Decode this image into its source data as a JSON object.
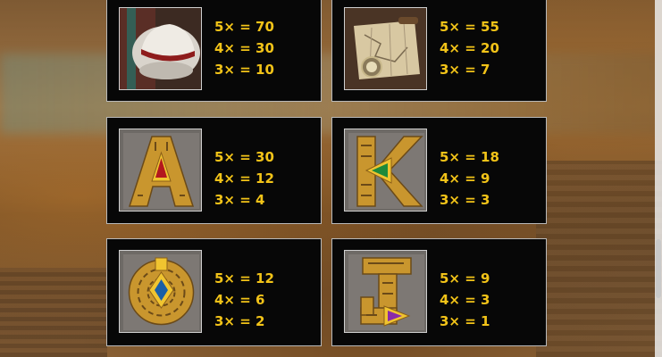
{
  "paytable": [
    {
      "symbol_icon": "hat-icon",
      "pays": [
        "5× = 70",
        "4× = 30",
        "3× = 10"
      ]
    },
    {
      "symbol_icon": "map-icon",
      "pays": [
        "5× = 55",
        "4× = 20",
        "3× = 7"
      ]
    },
    {
      "symbol_icon": "letter-a-icon",
      "pays": [
        "5× = 30",
        "4× = 12",
        "3× = 4"
      ]
    },
    {
      "symbol_icon": "letter-k-icon",
      "pays": [
        "5× = 18",
        "4× = 9",
        "3× = 3"
      ]
    },
    {
      "symbol_icon": "letter-q-icon",
      "pays": [
        "5× = 12",
        "4× = 6",
        "3× = 2"
      ]
    },
    {
      "symbol_icon": "letter-j-icon",
      "pays": [
        "5× = 9",
        "4× = 3",
        "3× = 1"
      ]
    }
  ],
  "colors": {
    "payout_text": "#f2c318",
    "panel_bg": "#070707",
    "panel_border": "#b9b9b9",
    "gold": "#c9962e",
    "stone": "#6e6a66"
  }
}
